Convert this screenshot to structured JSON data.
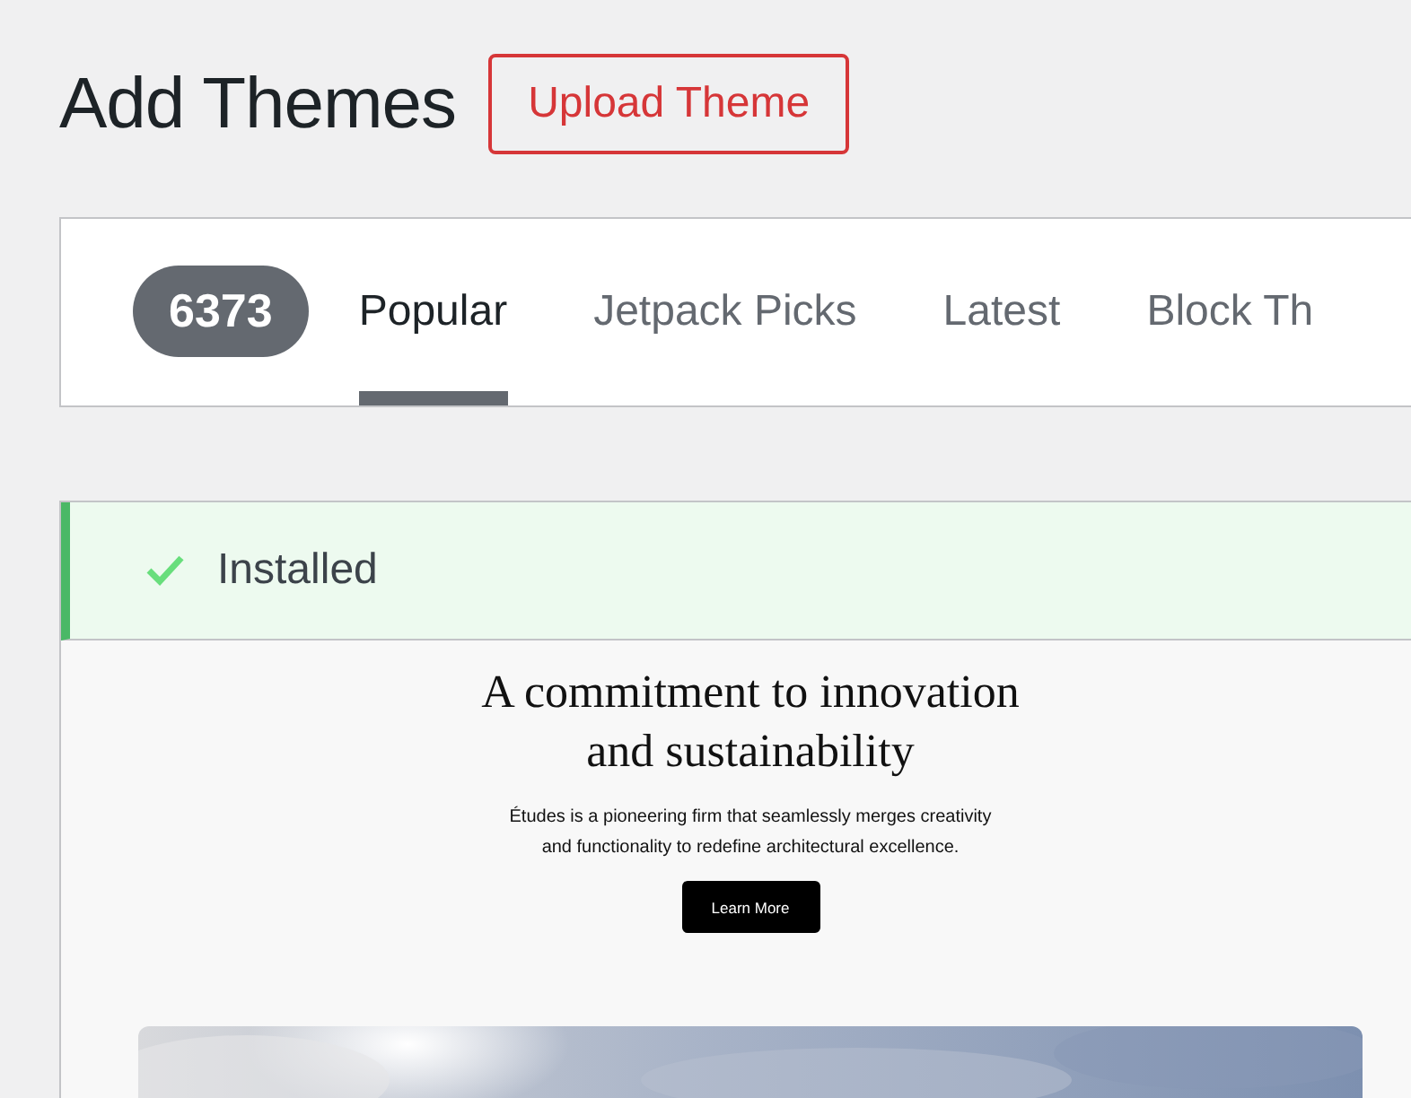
{
  "page_title": "Add Themes",
  "upload_button": "Upload Theme",
  "filter": {
    "count": "6373",
    "tabs": [
      {
        "label": "Popular",
        "selected": true
      },
      {
        "label": "Jetpack Picks",
        "selected": false
      },
      {
        "label": "Latest",
        "selected": false
      },
      {
        "label": "Block Th",
        "selected": false
      }
    ]
  },
  "theme": {
    "installed": true,
    "notice": "Installed",
    "preview": {
      "heading": "A commitment to innovation and sustainability",
      "text": "Études is a pioneering firm that seamlessly merges creativity and functionality to redefine architectural excellence.",
      "button": "Learn More"
    }
  }
}
